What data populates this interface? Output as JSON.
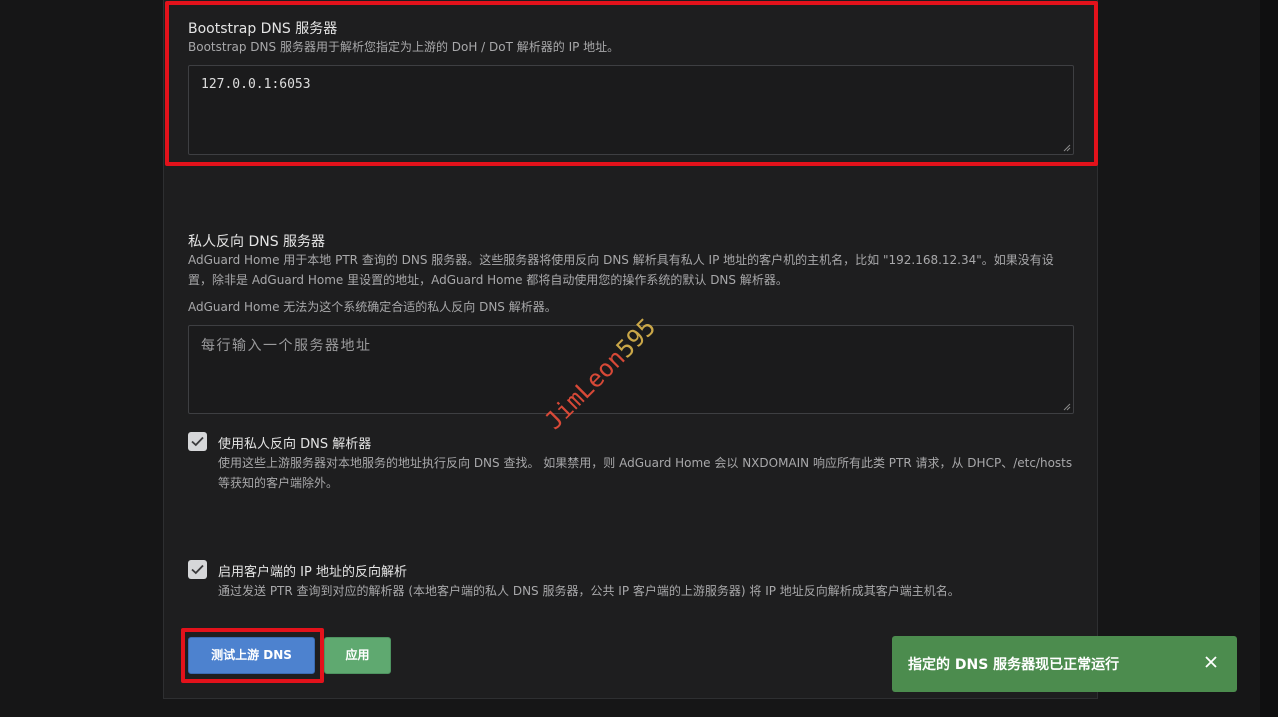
{
  "bootstrap": {
    "title": "Bootstrap DNS 服务器",
    "description": "Bootstrap DNS 服务器用于解析您指定为上游的 DoH / DoT 解析器的 IP 地址。",
    "value": "127.0.0.1:6053"
  },
  "private_reverse": {
    "title": "私人反向 DNS 服务器",
    "description": "AdGuard Home 用于本地 PTR 查询的 DNS 服务器。这些服务器将使用反向 DNS 解析具有私人 IP 地址的客户机的主机名，比如 \"192.168.12.34\"。如果没有设置，除非是 AdGuard Home 里设置的地址，AdGuard Home 都将自动使用您的操作系统的默认 DNS 解析器。",
    "note": "AdGuard Home 无法为这个系统确定合适的私人反向 DNS 解析器。",
    "placeholder": "每行输入一个服务器地址"
  },
  "use_private": {
    "label": "使用私人反向 DNS 解析器",
    "description": "使用这些上游服务器对本地服务的地址执行反向 DNS 查找。 如果禁用，则 AdGuard Home 会以 NXDOMAIN 响应所有此类 PTR 请求，从 DHCP、/etc/hosts 等获知的客户端除外。",
    "checked": true
  },
  "reverse_resolve": {
    "label": "启用客户端的 IP 地址的反向解析",
    "description": "通过发送 PTR 查询到对应的解析器 (本地客户端的私人 DNS 服务器，公共 IP 客户端的上游服务器) 将 IP 地址反向解析成其客户端主机名。",
    "checked": true
  },
  "buttons": {
    "test_upstream": "测试上游 DNS",
    "apply": "应用"
  },
  "toast": {
    "message": "指定的 DNS 服务器现已正常运行"
  },
  "watermark": {
    "main": "JimLeon",
    "tail": "595"
  },
  "colors": {
    "highlight": "#e3121b",
    "primary": "#4d82cf",
    "success": "#5fa970",
    "toast": "#4c8c4e"
  }
}
